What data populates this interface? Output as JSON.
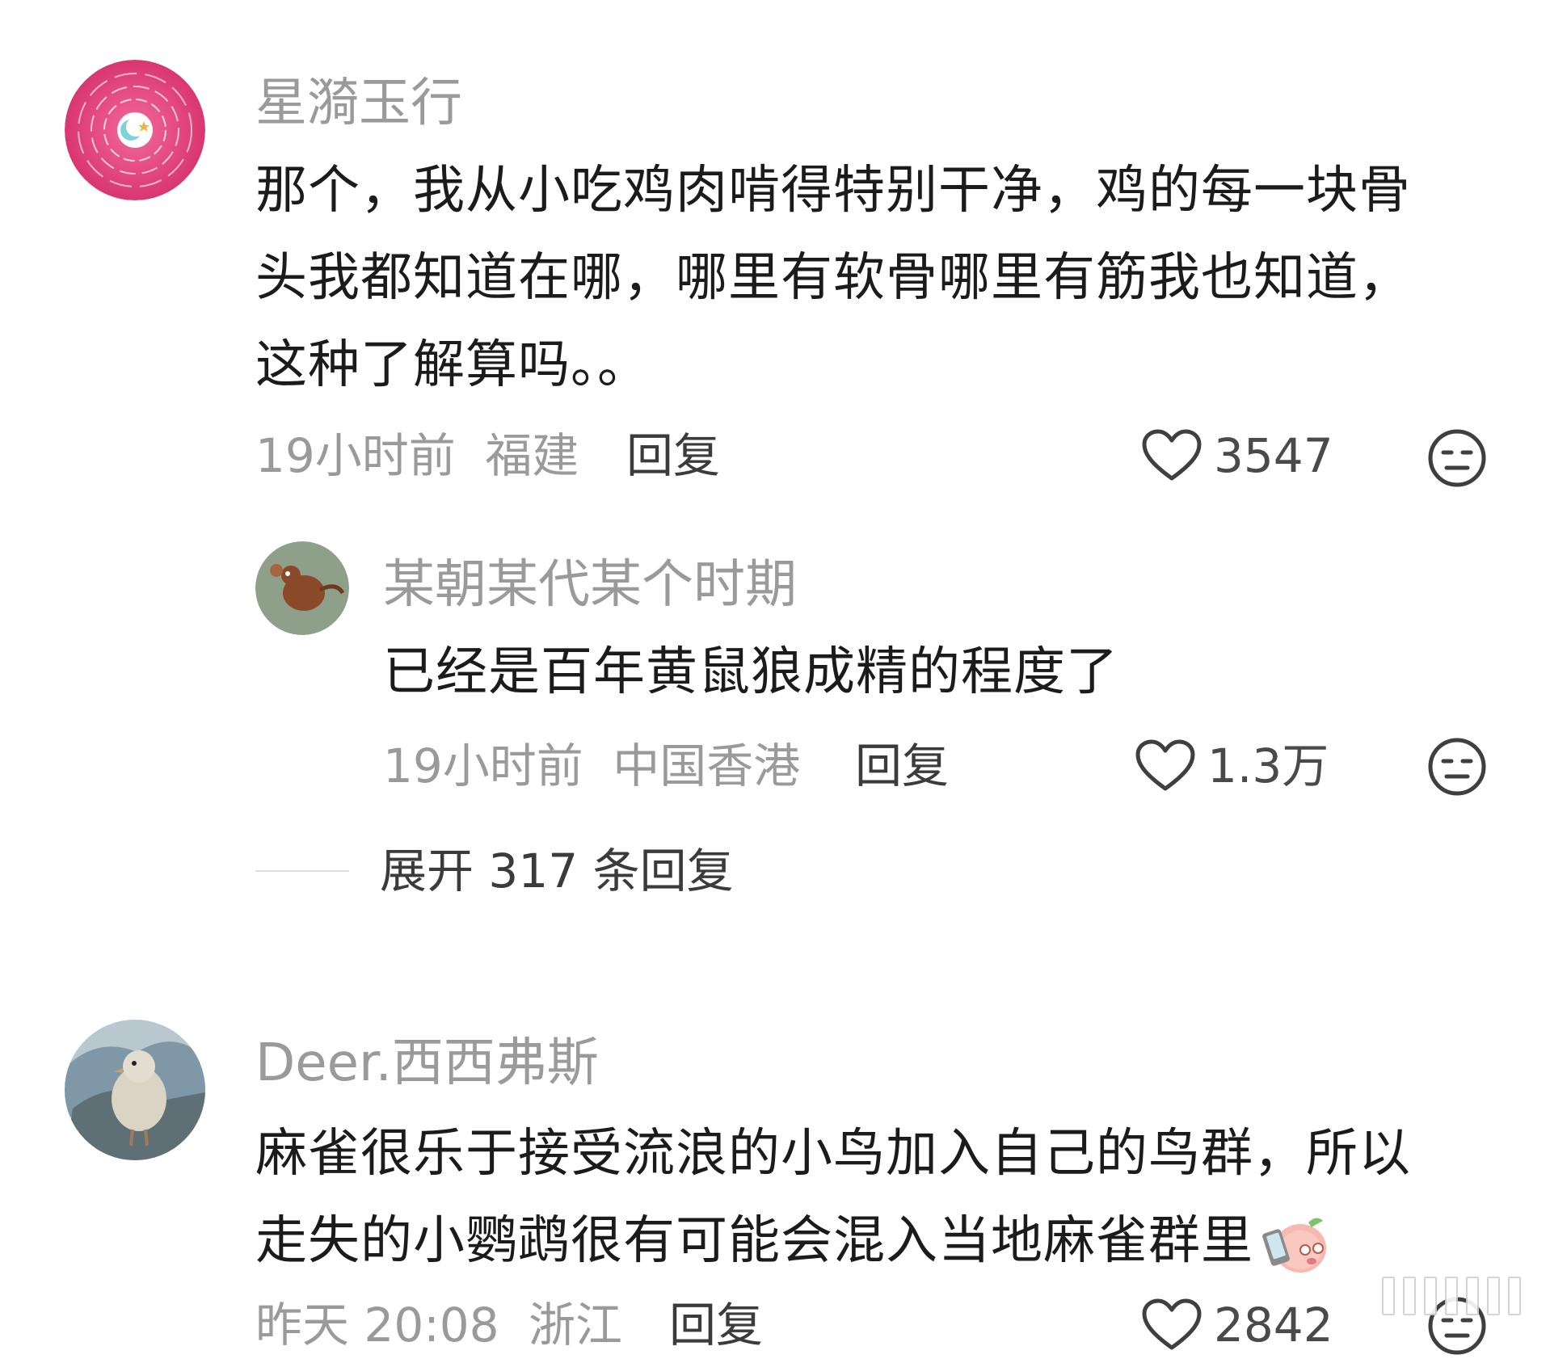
{
  "comments": [
    {
      "author": "星漪玉行",
      "body_lines": [
        "那个，我从小吃鸡肉啃得特别干净，鸡的每一块骨",
        "头我都知道在哪，哪里有软骨哪里有筋我也知道，",
        "这种了解算吗。。"
      ],
      "time": "19小时前",
      "location": "福建",
      "reply_label": "回复",
      "likes": "3547",
      "avatar_icon": "moon-star-circle-avatar",
      "avatar_color": "#e2447c"
    },
    {
      "author": "Deer.西西弗斯",
      "body_lines": [
        "麻雀很乐于接受流浪的小鸟加入自己的鸟群，所以",
        "走失的小鹦鹉很有可能会混入当地麻雀群里"
      ],
      "time": "昨天 20:08",
      "location": "浙江",
      "reply_label": "回复",
      "likes": "2842",
      "avatar_icon": "pigeon-photo-avatar",
      "inline_emoji": "pig-phone-emoji"
    }
  ],
  "reply": {
    "author": "某朝某代某个时期",
    "body": "已经是百年黄鼠狼成精的程度了",
    "time": "19小时前",
    "location": "中国香港",
    "reply_label": "回复",
    "likes": "1.3万",
    "avatar_icon": "cartoon-rat-avatar"
  },
  "expand_replies": {
    "label": "展开 317 条回复"
  },
  "colors": {
    "background": "#ffffff",
    "text": "#1b1b1b",
    "muted": "#9a9a9a",
    "action": "#3b3b3b"
  }
}
